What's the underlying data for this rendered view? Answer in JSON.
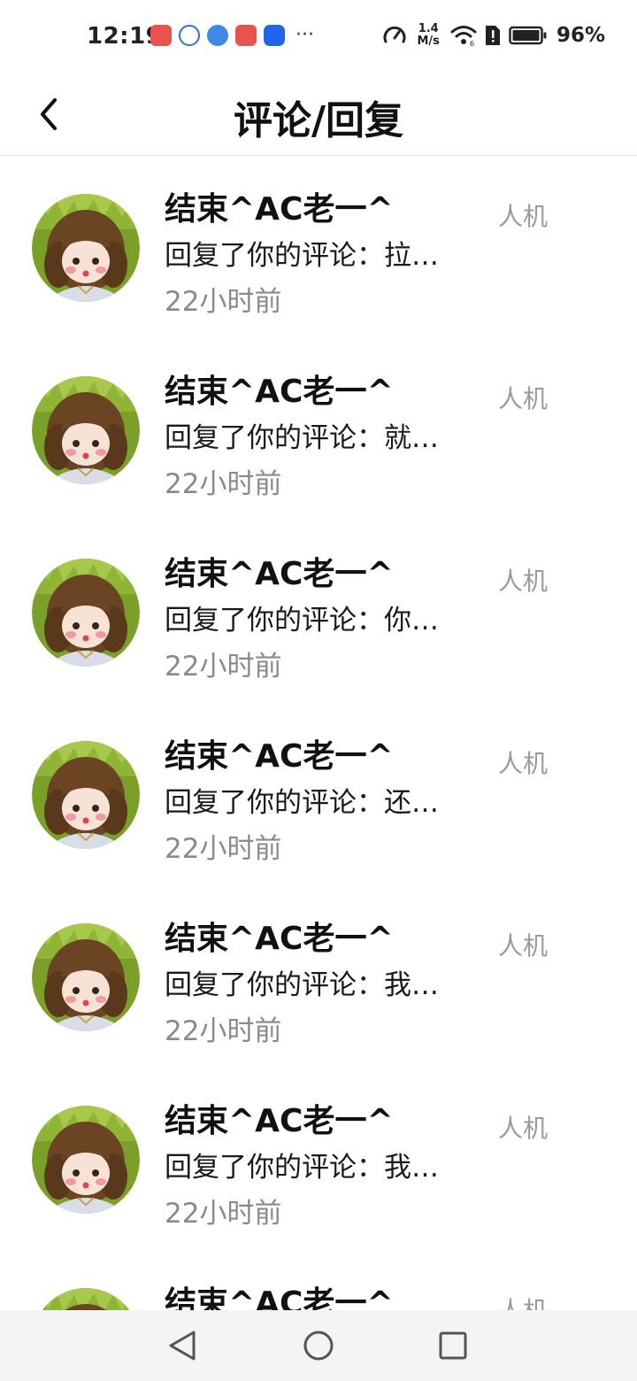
{
  "status_bar": {
    "time": "12:19",
    "notification_icons": [
      "shopping-app-icon",
      "baidu-paw-icon",
      "browser-globe-icon",
      "shopping-app-icon",
      "lightbulb-app-icon"
    ],
    "more": "···",
    "net_speed_value": "1.4",
    "net_speed_unit": "M/s",
    "battery_percent": "96%"
  },
  "header": {
    "back_icon": "chevron-left-icon",
    "title": "评论/回复"
  },
  "comments": [
    {
      "name": "结束^AC老一^",
      "text": "回复了你的评论：拉…",
      "time": "22小时前",
      "tag": "人机"
    },
    {
      "name": "结束^AC老一^",
      "text": "回复了你的评论：就…",
      "time": "22小时前",
      "tag": "人机"
    },
    {
      "name": "结束^AC老一^",
      "text": "回复了你的评论：你…",
      "time": "22小时前",
      "tag": "人机"
    },
    {
      "name": "结束^AC老一^",
      "text": "回复了你的评论：还…",
      "time": "22小时前",
      "tag": "人机"
    },
    {
      "name": "结束^AC老一^",
      "text": "回复了你的评论：我…",
      "time": "22小时前",
      "tag": "人机"
    },
    {
      "name": "结束^AC老一^",
      "text": "回复了你的评论：我…",
      "time": "22小时前",
      "tag": "人机"
    },
    {
      "name": "结束^AC老一^",
      "text": "",
      "time": "",
      "tag": "人机"
    }
  ],
  "colors": {
    "primary_text": "#111111",
    "secondary_text": "#8a8a8a",
    "tag_text": "#9a9a9a",
    "divider": "#e6e6e6",
    "nav_background": "#f4f4f4"
  }
}
